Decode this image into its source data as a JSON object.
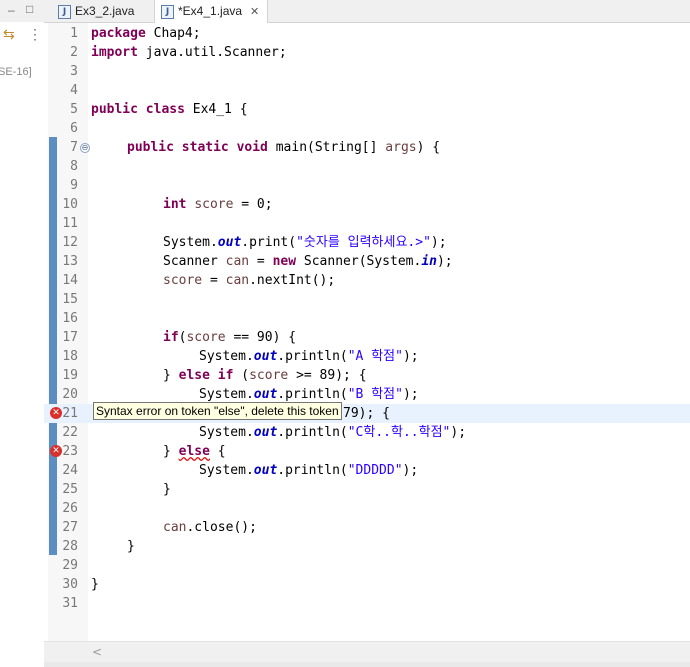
{
  "left_panel": {
    "minimize_glyph": "–",
    "maximize_glyph": "□",
    "hierarchy_icon": "⇆",
    "menu_icon": "⋮",
    "jre_label": "SE-16]"
  },
  "tabs": [
    {
      "label": "Ex3_2.java",
      "icon": "J"
    },
    {
      "label": "*Ex4_1.java",
      "icon": "J",
      "close": "✕"
    }
  ],
  "editor": {
    "lines": [
      {
        "n": "1"
      },
      {
        "n": "2"
      },
      {
        "n": "3"
      },
      {
        "n": "4"
      },
      {
        "n": "5"
      },
      {
        "n": "6"
      },
      {
        "n": "7"
      },
      {
        "n": "8"
      },
      {
        "n": "9"
      },
      {
        "n": "10"
      },
      {
        "n": "11"
      },
      {
        "n": "12"
      },
      {
        "n": "13"
      },
      {
        "n": "14"
      },
      {
        "n": "15"
      },
      {
        "n": "16"
      },
      {
        "n": "17"
      },
      {
        "n": "18"
      },
      {
        "n": "19"
      },
      {
        "n": "20"
      },
      {
        "n": "21"
      },
      {
        "n": "22"
      },
      {
        "n": "23"
      },
      {
        "n": "24"
      },
      {
        "n": "25"
      },
      {
        "n": "26"
      },
      {
        "n": "27"
      },
      {
        "n": "28"
      },
      {
        "n": "29"
      },
      {
        "n": "30"
      },
      {
        "n": "31"
      }
    ],
    "fold_glyph": "⊖",
    "error_glyph": "✕",
    "tooltip": "Syntax error on token \"else\", delete this token",
    "scroll_left": "<",
    "code": {
      "l1_kw": "package",
      "l1_rest": " Chap4;",
      "l2_kw": "import",
      "l2_rest": " java.util.Scanner;",
      "l5_kw": "public class",
      "l5_rest": " Ex4_1 {",
      "l7_kw": "public static void",
      "l7_rest": " main(String[] ",
      "l7_var": "args",
      "l7_end": ") {",
      "l10_kw": "int",
      "l10_sp": " ",
      "l10_var": "score",
      "l10_rest": " = 0;",
      "l12_a": "System.",
      "l12_fld": "out",
      "l12_b": ".print(",
      "l12_str": "\"숫자를 입력하세요.>\"",
      "l12_c": ");",
      "l13_a": "Scanner ",
      "l13_var": "can",
      "l13_b": " = ",
      "l13_kw": "new",
      "l13_c": " Scanner(System.",
      "l13_fld": "in",
      "l13_d": ");",
      "l14_var1": "score",
      "l14_a": " = ",
      "l14_var2": "can",
      "l14_b": ".nextInt();",
      "l17_kw": "if",
      "l17_a": "(",
      "l17_var": "score",
      "l17_b": " == 90) {",
      "l18_a": "System.",
      "l18_fld": "out",
      "l18_b": ".println(",
      "l18_str": "\"A 학점\"",
      "l18_c": ");",
      "l19_a": "} ",
      "l19_kw": "else if",
      "l19_b": " (",
      "l19_var": "score",
      "l19_c": " >= 89); {",
      "l20_a": "System.",
      "l20_fld": "out",
      "l20_b": ".println(",
      "l20_str": "\"B 학점\"",
      "l20_c": ");",
      "l21_a": "79); {",
      "l22_a": "System.",
      "l22_fld": "out",
      "l22_b": ".println(",
      "l22_str": "\"C학..학..학점\"",
      "l22_c": ");",
      "l23_a": "} ",
      "l23_kw": "else",
      "l23_b": " {",
      "l24_a": "System.",
      "l24_fld": "out",
      "l24_b": ".println(",
      "l24_str": "\"DDDDD\"",
      "l24_c": ");",
      "l25": "}",
      "l27_var": "can",
      "l27_a": ".close();",
      "l28": "}",
      "l30": "}"
    }
  }
}
